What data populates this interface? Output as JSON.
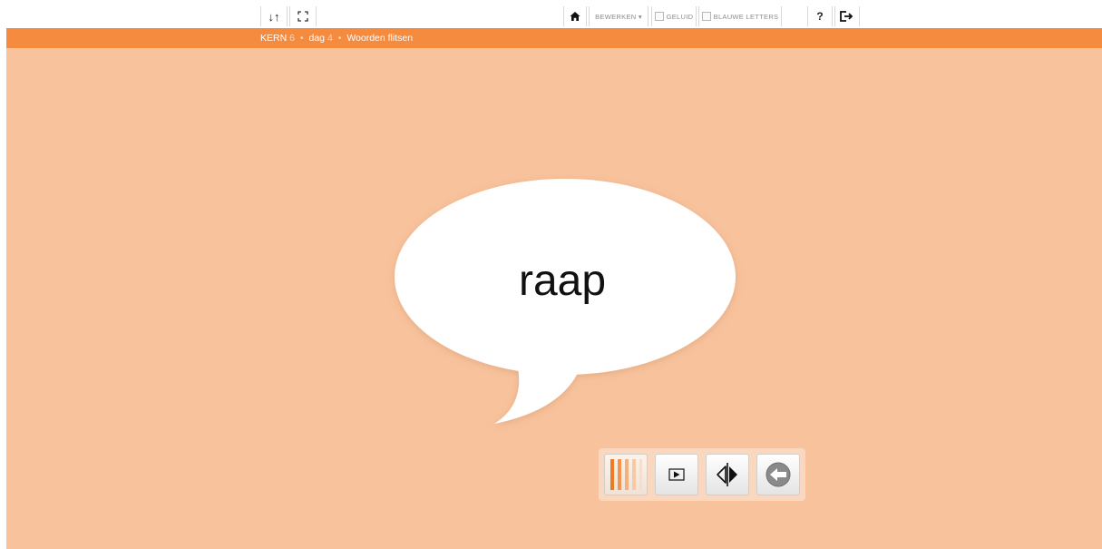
{
  "toolbar": {
    "sort_icon": "↓↑",
    "fullscreen_icon": "⛶",
    "home_icon": "home-icon",
    "bewerken_label": "BEWERKEN ▾",
    "geluid_label": "GELUID",
    "blauwe_letters_label": "BLAUWE LETTERS",
    "help_label": "?",
    "logout_icon": "logout-icon"
  },
  "breadcrumb": {
    "kern_label": "KERN",
    "kern_num": "6",
    "sep1": "•",
    "dag_label": "dag",
    "dag_num": "4",
    "sep2": "•",
    "activity": "Woorden flitsen"
  },
  "main": {
    "word": "raap"
  },
  "controls": {
    "speed_icon": "speed-bars-icon",
    "play_icon": "play-icon",
    "split_icon": "split-arrows-icon",
    "back_icon": "back-arrow-icon"
  },
  "colors": {
    "accent": "#f58b3f",
    "background": "#f7c29c",
    "controls_bg": "#f9d8bf"
  }
}
